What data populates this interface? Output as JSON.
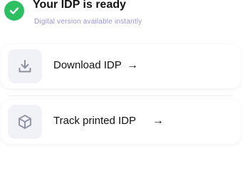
{
  "status": {
    "title": "Your IDP is ready",
    "subtitle": "Digital version available instantly",
    "icon": "check-circle-icon",
    "color": "#2fbf63",
    "subtitle_color": "#9b93d6"
  },
  "actions": [
    {
      "label": "Download IDP",
      "icon": "download-icon",
      "arrow": "→"
    },
    {
      "label": "Track printed IDP",
      "icon": "package-icon",
      "arrow": "→"
    }
  ],
  "colors": {
    "text": "#111111",
    "icon_tile": "#f1f2f7",
    "icon": "#8a8ea0"
  }
}
